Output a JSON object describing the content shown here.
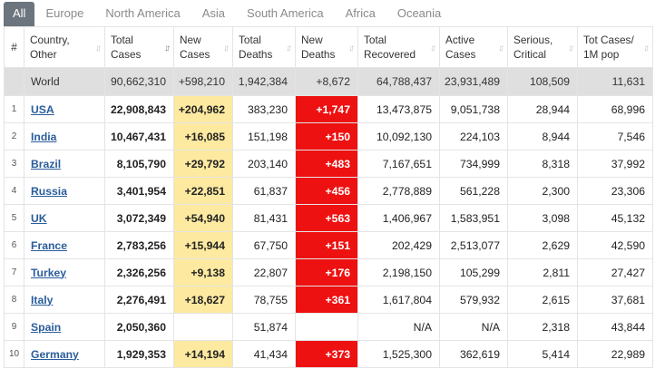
{
  "tabs": [
    "All",
    "Europe",
    "North America",
    "Asia",
    "South America",
    "Africa",
    "Oceania"
  ],
  "headers": {
    "num": "#",
    "country": [
      "Country,",
      "Other"
    ],
    "total_cases": [
      "Total",
      "Cases"
    ],
    "new_cases": [
      "New",
      "Cases"
    ],
    "total_deaths": [
      "Total",
      "Deaths"
    ],
    "new_deaths": [
      "New",
      "Deaths"
    ],
    "total_recovered": [
      "Total",
      "Recovered"
    ],
    "active_cases": [
      "Active",
      "Cases"
    ],
    "serious": [
      "Serious,",
      "Critical"
    ],
    "tot_cases_pop": [
      "Tot Cases/",
      "1M pop"
    ]
  },
  "world": {
    "country": "World",
    "total_cases": "90,662,310",
    "new_cases": "+598,210",
    "total_deaths": "1,942,384",
    "new_deaths": "+8,672",
    "total_recovered": "64,788,437",
    "active_cases": "23,931,489",
    "serious": "108,509",
    "tot_cases_pop": "11,631"
  },
  "rows": [
    {
      "num": "1",
      "country": "USA",
      "total_cases": "22,908,843",
      "new_cases": "+204,962",
      "total_deaths": "383,230",
      "new_deaths": "+1,747",
      "total_recovered": "13,473,875",
      "active_cases": "9,051,738",
      "serious": "28,944",
      "tot_cases_pop": "68,996"
    },
    {
      "num": "2",
      "country": "India",
      "total_cases": "10,467,431",
      "new_cases": "+16,085",
      "total_deaths": "151,198",
      "new_deaths": "+150",
      "total_recovered": "10,092,130",
      "active_cases": "224,103",
      "serious": "8,944",
      "tot_cases_pop": "7,546"
    },
    {
      "num": "3",
      "country": "Brazil",
      "total_cases": "8,105,790",
      "new_cases": "+29,792",
      "total_deaths": "203,140",
      "new_deaths": "+483",
      "total_recovered": "7,167,651",
      "active_cases": "734,999",
      "serious": "8,318",
      "tot_cases_pop": "37,992"
    },
    {
      "num": "4",
      "country": "Russia",
      "total_cases": "3,401,954",
      "new_cases": "+22,851",
      "total_deaths": "61,837",
      "new_deaths": "+456",
      "total_recovered": "2,778,889",
      "active_cases": "561,228",
      "serious": "2,300",
      "tot_cases_pop": "23,306"
    },
    {
      "num": "5",
      "country": "UK",
      "total_cases": "3,072,349",
      "new_cases": "+54,940",
      "total_deaths": "81,431",
      "new_deaths": "+563",
      "total_recovered": "1,406,967",
      "active_cases": "1,583,951",
      "serious": "3,098",
      "tot_cases_pop": "45,132"
    },
    {
      "num": "6",
      "country": "France",
      "total_cases": "2,783,256",
      "new_cases": "+15,944",
      "total_deaths": "67,750",
      "new_deaths": "+151",
      "total_recovered": "202,429",
      "active_cases": "2,513,077",
      "serious": "2,629",
      "tot_cases_pop": "42,590"
    },
    {
      "num": "7",
      "country": "Turkey",
      "total_cases": "2,326,256",
      "new_cases": "+9,138",
      "total_deaths": "22,807",
      "new_deaths": "+176",
      "total_recovered": "2,198,150",
      "active_cases": "105,299",
      "serious": "2,811",
      "tot_cases_pop": "27,427"
    },
    {
      "num": "8",
      "country": "Italy",
      "total_cases": "2,276,491",
      "new_cases": "+18,627",
      "total_deaths": "78,755",
      "new_deaths": "+361",
      "total_recovered": "1,617,804",
      "active_cases": "579,932",
      "serious": "2,615",
      "tot_cases_pop": "37,681"
    },
    {
      "num": "9",
      "country": "Spain",
      "total_cases": "2,050,360",
      "new_cases": "",
      "total_deaths": "51,874",
      "new_deaths": "",
      "total_recovered": "N/A",
      "active_cases": "N/A",
      "serious": "2,318",
      "tot_cases_pop": "43,844"
    },
    {
      "num": "10",
      "country": "Germany",
      "total_cases": "1,929,353",
      "new_cases": "+14,194",
      "total_deaths": "41,434",
      "new_deaths": "+373",
      "total_recovered": "1,525,300",
      "active_cases": "362,619",
      "serious": "5,414",
      "tot_cases_pop": "22,989"
    }
  ],
  "colors": {
    "active_tab_bg": "#6c757d",
    "new_cases_bg": "#fde9a0",
    "new_deaths_bg": "#ee1111",
    "world_row_bg": "#dfdfdf",
    "link": "#2a5d9b"
  }
}
